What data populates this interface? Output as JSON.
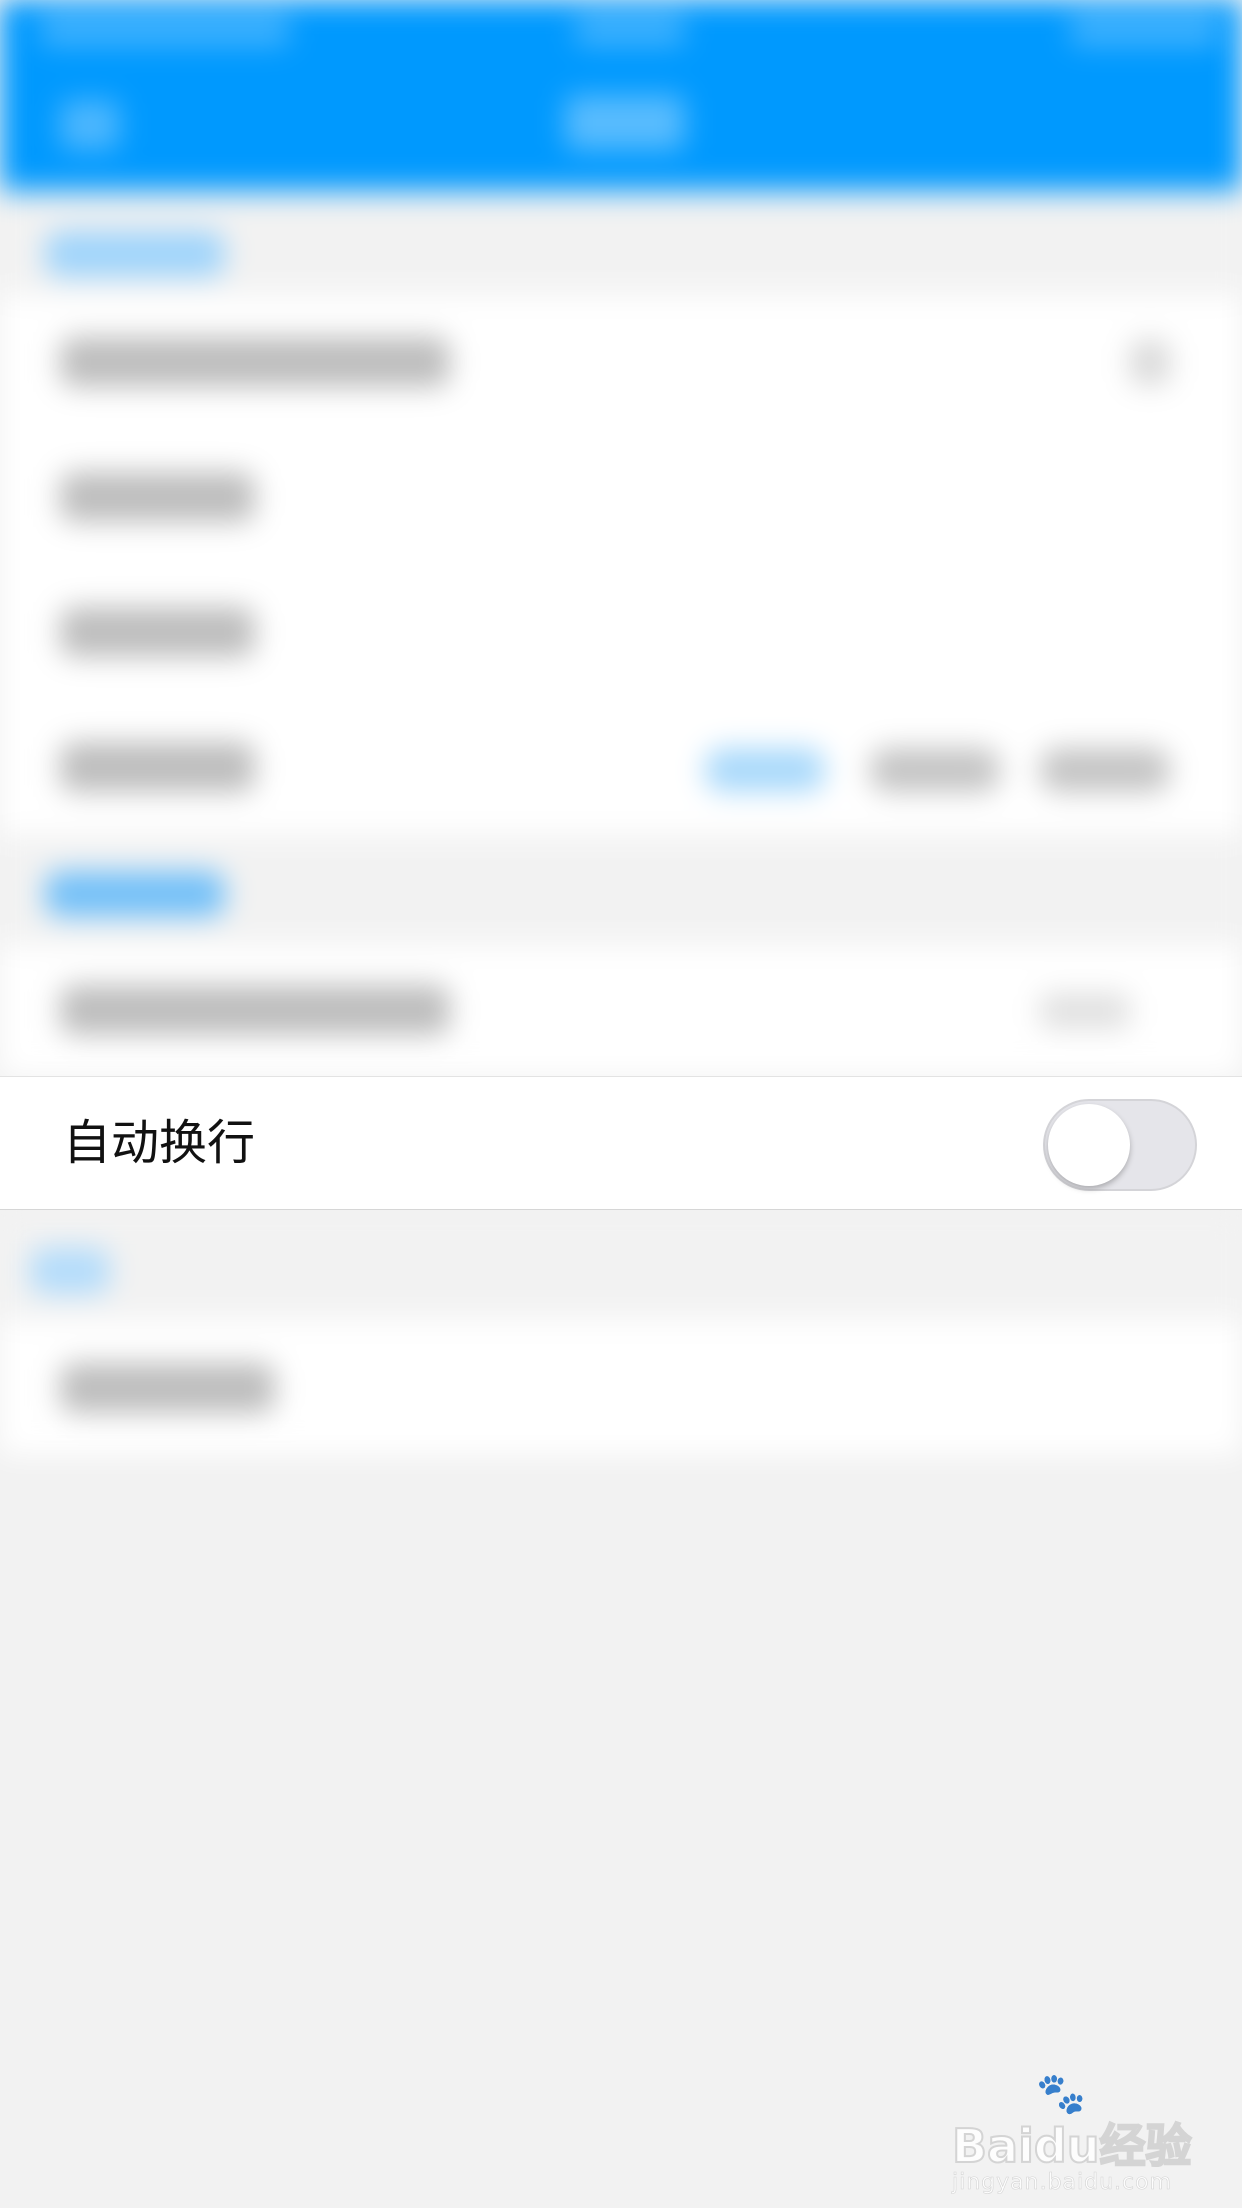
{
  "settings": {
    "auto_wrap_label": "自动换行",
    "auto_wrap_enabled": false
  },
  "watermark": {
    "logo": "Baidu经验",
    "url": "jingyan.baidu.com"
  },
  "colors": {
    "nav_bar": "#0099fe",
    "page_background": "#f2f2f2",
    "toggle_off": "#e5e5ea"
  }
}
